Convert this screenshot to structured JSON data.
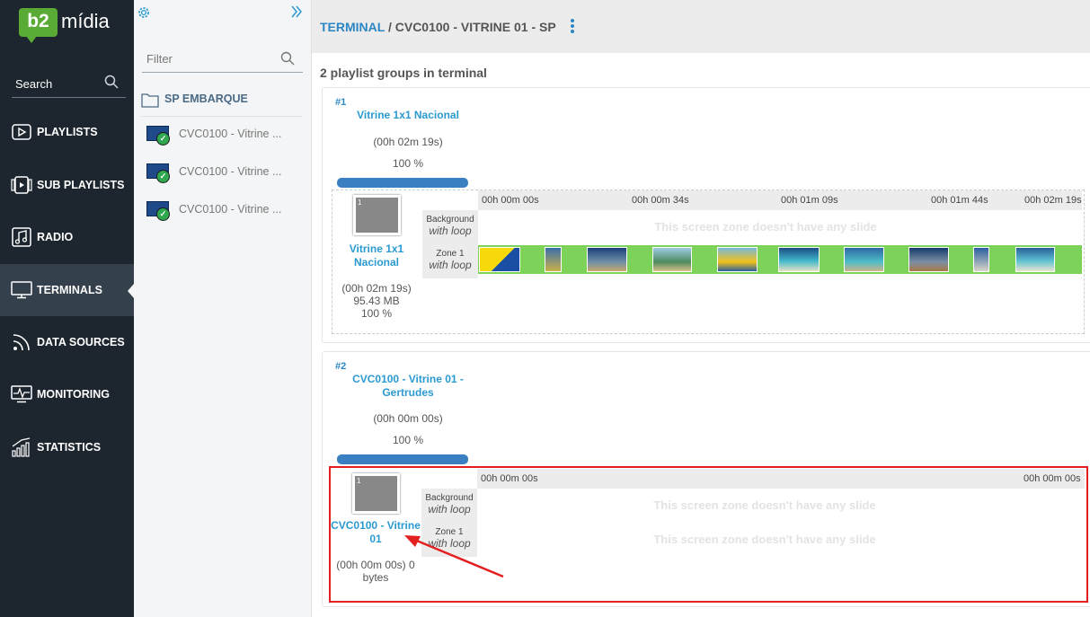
{
  "brand": {
    "badge": "b2",
    "name": "mídia"
  },
  "nav": {
    "search_label": "Search",
    "items": [
      {
        "label": "PLAYLISTS",
        "icon": "play-icon"
      },
      {
        "label": "SUB PLAYLISTS",
        "icon": "sub-playlist-icon"
      },
      {
        "label": "RADIO",
        "icon": "music-icon"
      },
      {
        "label": "TERMINALS",
        "icon": "monitor-icon",
        "active": true
      },
      {
        "label": "DATA SOURCES",
        "icon": "rss-icon"
      },
      {
        "label": "MONITORING",
        "icon": "monitoring-icon"
      },
      {
        "label": "STATISTICS",
        "icon": "statistics-icon"
      }
    ]
  },
  "tree": {
    "filter_placeholder": "Filter",
    "folder": "SP EMBARQUE",
    "terminals": [
      "CVC0100 - Vitrine ...",
      "CVC0100 - Vitrine ...",
      "CVC0100 - Vitrine ..."
    ]
  },
  "header": {
    "section": "TERMINAL",
    "separator": " / ",
    "title": "CVC0100 - VITRINE 01 - SP"
  },
  "summary": "2 playlist groups in terminal",
  "groups": [
    {
      "index": "#1",
      "name": "Vitrine 1x1 Nacional",
      "duration": "(00h 02m 19s)",
      "percent": "100 %",
      "progress": 1.0,
      "playlist": {
        "thumb_number": "1",
        "name": "Vitrine 1x1 Nacional",
        "duration": "(00h 02m 19s)",
        "size": "95.43 MB",
        "percent": "100 %"
      },
      "timeline": [
        "00h 00m 00s",
        "00h 00m 34s",
        "00h 01m 09s",
        "00h 01m 44s",
        "00h 02m 19s"
      ],
      "zones": [
        {
          "name": "Background",
          "loop": "with loop",
          "empty_text": "This screen zone doesn't have any slide"
        },
        {
          "name": "Zone 1",
          "loop": "with loop",
          "empty_text": ""
        }
      ]
    },
    {
      "index": "#2",
      "name": "CVC0100 - Vitrine 01 - Gertrudes",
      "duration": "(00h 00m 00s)",
      "percent": "100 %",
      "progress": 1.0,
      "playlist": {
        "thumb_number": "1",
        "name": "CVC0100 - Vitrine 01",
        "duration": "(00h 00m 00s) 0 bytes",
        "size": "",
        "percent": ""
      },
      "timeline": [
        "00h 00m 00s",
        "00h 00m 00s"
      ],
      "zones": [
        {
          "name": "Background",
          "loop": "with loop",
          "empty_text": "This screen zone doesn't have any slide"
        },
        {
          "name": "Zone 1",
          "loop": "with loop",
          "empty_text": "This screen zone doesn't have any slide"
        }
      ]
    }
  ],
  "colors": {
    "accent": "#2b86c4",
    "sidebar": "#1d252e",
    "brand_green": "#5aab36",
    "highlight": "#e41f1f",
    "zone_green": "#7dd35a"
  }
}
